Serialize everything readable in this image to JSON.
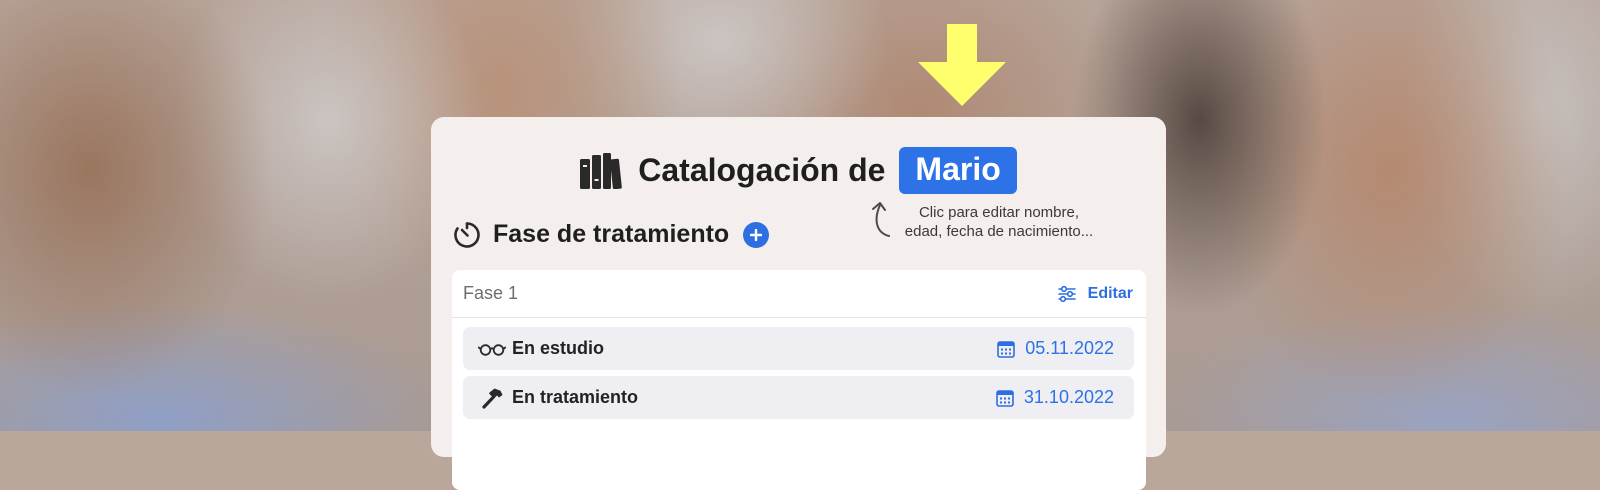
{
  "header": {
    "title": "Catalogación de",
    "name": "Mario",
    "hint_line1": "Clic para editar nombre,",
    "hint_line2": "edad, fecha de nacimiento..."
  },
  "section": {
    "title": "Fase de tratamiento"
  },
  "phase": {
    "label": "Fase 1",
    "edit_label": "Editar",
    "items": [
      {
        "label": "En estudio",
        "icon": "glasses-icon",
        "date": "05.11.2022"
      },
      {
        "label": "En tratamiento",
        "icon": "hammer-icon",
        "date": "31.10.2022"
      }
    ]
  },
  "colors": {
    "accent": "#2d72e6",
    "highlight_arrow": "#ffff6e",
    "card_bg": "#f4efec",
    "row_bg": "#eeeef3"
  }
}
